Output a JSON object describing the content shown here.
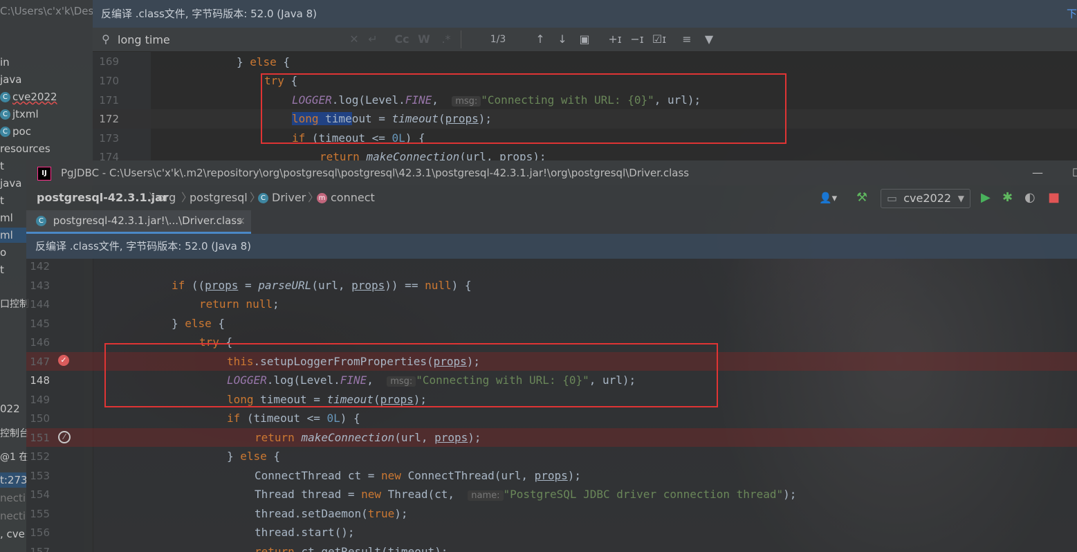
{
  "sidebar": {
    "items": [
      {
        "label": "C:\\Users\\c'x'k\\Desk",
        "icon": ""
      },
      {
        "label": "in",
        "icon": ""
      },
      {
        "label": "java",
        "icon": ""
      },
      {
        "label": "cve2022",
        "icon": "class-icon"
      },
      {
        "label": "jtxml",
        "icon": "class-icon"
      },
      {
        "label": "poc",
        "icon": "class-icon"
      },
      {
        "label": "resources",
        "icon": ""
      },
      {
        "label": "t",
        "icon": ""
      },
      {
        "label": "java",
        "icon": ""
      },
      {
        "label": "t",
        "icon": ""
      },
      {
        "label": "ml",
        "icon": ""
      },
      {
        "label": "ml",
        "icon": ""
      },
      {
        "label": "o",
        "icon": ""
      },
      {
        "label": "t",
        "icon": ""
      },
      {
        "label": "口控制",
        "icon": ""
      },
      {
        "label": "022",
        "icon": ""
      },
      {
        "label": "控制台",
        "icon": ""
      },
      {
        "label": "@1 在",
        "icon": ""
      },
      {
        "label": "t:273",
        "icon": ""
      },
      {
        "label": "necti",
        "icon": ""
      },
      {
        "label": "necti",
        "icon": ""
      },
      {
        "label": ", cve",
        "icon": ""
      }
    ]
  },
  "back_editor": {
    "banner": "反编译 .class文件, 字节码版本: 52.0 (Java 8)",
    "banner_right": "下",
    "search": {
      "value": "long time",
      "counter": "1/3",
      "match_case": "Cc",
      "words": "W",
      "regex": ".*"
    },
    "line_numbers": [
      "169",
      "170",
      "171",
      "172",
      "173",
      "174"
    ]
  },
  "front_window": {
    "title": "PgJDBC - C:\\Users\\c'x'k\\.m2\\repository\\org\\postgresql\\postgresql\\42.3.1\\postgresql-42.3.1.jar!\\org\\postgresql\\Driver.class",
    "breadcrumb": [
      "postgresql-42.3.1.jar",
      "org",
      "postgresql",
      "Driver",
      "connect"
    ],
    "run_config": "cve2022",
    "tab_label": "postgresql-42.3.1.jar!\\...\\Driver.class",
    "banner": "反编译 .class文件, 字节码版本: 52.0 (Java 8)",
    "line_numbers": [
      "142",
      "143",
      "144",
      "145",
      "146",
      "147",
      "148",
      "149",
      "150",
      "151",
      "152",
      "153",
      "154",
      "155",
      "156",
      "157"
    ]
  },
  "code": {
    "hint_msg": "msg:",
    "hint_name": "name:",
    "str_connecting": "\"Connecting with URL: {0}\"",
    "str_thread": "\"PostgreSQL JDBC driver connection thread\""
  },
  "icons": {
    "breakpoint": "breakpoint-check-icon",
    "disabled_breakpoint": "breakpoint-disabled-icon"
  }
}
